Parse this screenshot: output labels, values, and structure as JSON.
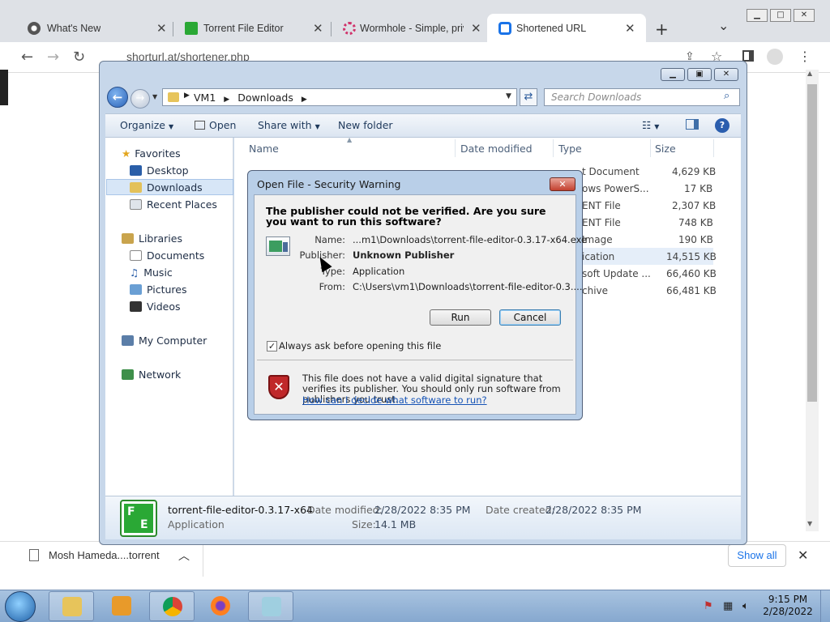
{
  "browser": {
    "tabs": [
      {
        "label": "What's New",
        "icon": "chrome-icon",
        "active": false
      },
      {
        "label": "Torrent File Editor",
        "icon": "torrent-file-editor-icon",
        "active": false
      },
      {
        "label": "Wormhole - Simple, priv",
        "icon": "wormhole-icon",
        "active": false
      },
      {
        "label": "Shortened URL",
        "icon": "shortened-url-icon",
        "active": true
      }
    ],
    "new_tab": "+",
    "tab_search": "⌄",
    "address": "shorturl.at/shortener.php"
  },
  "explorer": {
    "breadcrumb": [
      "VM1",
      "Downloads"
    ],
    "search_placeholder": "Search Downloads",
    "commands": {
      "organize": "Organize",
      "open": "Open",
      "share_with": "Share with",
      "new_folder": "New folder"
    },
    "nav": {
      "favorites": "Favorites",
      "desktop": "Desktop",
      "downloads": "Downloads",
      "recent_places": "Recent Places",
      "libraries": "Libraries",
      "documents": "Documents",
      "music": "Music",
      "pictures": "Pictures",
      "videos": "Videos",
      "my_computer": "My Computer",
      "network": "Network"
    },
    "columns": {
      "name": "Name",
      "date_modified": "Date modified",
      "type": "Type",
      "size": "Size"
    },
    "rows": [
      {
        "type": "t Document",
        "size": "4,629 KB"
      },
      {
        "type": "ows PowerS...",
        "size": "17 KB"
      },
      {
        "type": "ENT File",
        "size": "2,307 KB"
      },
      {
        "type": "ENT File",
        "size": "748 KB"
      },
      {
        "type": "Image",
        "size": "190 KB"
      },
      {
        "type": "ication",
        "size": "14,515 KB"
      },
      {
        "type": "soft Update ...",
        "size": "66,460 KB"
      },
      {
        "type": "chive",
        "size": "66,481 KB"
      }
    ],
    "details": {
      "filename": "torrent-file-editor-0.3.17-x64",
      "kind": "Application",
      "date_modified_label": "Date modified:",
      "date_modified": "2/28/2022 8:35 PM",
      "date_created_label": "Date created:",
      "date_created": "2/28/2022 8:35 PM",
      "size_label": "Size:",
      "size": "14.1 MB"
    }
  },
  "dialog": {
    "title": "Open File - Security Warning",
    "heading": "The publisher could not be verified.  Are you sure you want to run this software?",
    "labels": {
      "name": "Name:",
      "publisher": "Publisher:",
      "type": "Type:",
      "from": "From:"
    },
    "values": {
      "name": "...m1\\Downloads\\torrent-file-editor-0.3.17-x64.exe",
      "publisher": "Unknown Publisher",
      "type": "Application",
      "from": "C:\\Users\\vm1\\Downloads\\torrent-file-editor-0.3...."
    },
    "run": "Run",
    "cancel": "Cancel",
    "checkbox_label": "Always ask before opening this file",
    "checkbox_checked": true,
    "warning": "This file does not have a valid digital signature that verifies its publisher.  You should only run software from publishers you trust.",
    "link": "How can I decide what software to run?"
  },
  "download_bar": {
    "item": "Mosh Hameda....torrent",
    "show_all": "Show all"
  },
  "taskbar": {
    "time": "9:15 PM",
    "date": "2/28/2022"
  }
}
